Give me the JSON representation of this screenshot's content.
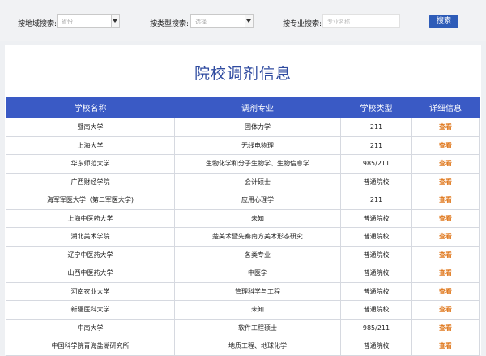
{
  "search": {
    "region_label": "按地域搜索:",
    "region_value": "省份",
    "type_label": "按类型搜索:",
    "type_value": "选择",
    "major_label": "按专业搜索:",
    "major_placeholder": "专业名称",
    "button_label": "搜索"
  },
  "page_title": "院校调剂信息",
  "table": {
    "headers": [
      "学校名称",
      "调剂专业",
      "学校类型",
      "详细信息"
    ],
    "rows": [
      {
        "school": "暨南大学",
        "major": "固体力学",
        "type": "211",
        "link": "查看"
      },
      {
        "school": "上海大学",
        "major": "无线电物理",
        "type": "211",
        "link": "查看"
      },
      {
        "school": "华东师范大学",
        "major": "生物化学和分子生物学、生物信息学",
        "type": "985/211",
        "link": "查看"
      },
      {
        "school": "广西财经学院",
        "major": "会计硕士",
        "type": "普通院校",
        "link": "查看"
      },
      {
        "school": "海军军医大学（第二军医大学)",
        "major": "应用心理学",
        "type": "211",
        "link": "查看"
      },
      {
        "school": "上海中医药大学",
        "major": "未知",
        "type": "普通院校",
        "link": "查看"
      },
      {
        "school": "湖北美术学院",
        "major": "楚美术暨先秦南方美术形态研究",
        "type": "普通院校",
        "link": "查看"
      },
      {
        "school": "辽宁中医药大学",
        "major": "各类专业",
        "type": "普通院校",
        "link": "查看"
      },
      {
        "school": "山西中医药大学",
        "major": "中医学",
        "type": "普通院校",
        "link": "查看"
      },
      {
        "school": "河南农业大学",
        "major": "管理科学与工程",
        "type": "普通院校",
        "link": "查看"
      },
      {
        "school": "新疆医科大学",
        "major": "未知",
        "type": "普通院校",
        "link": "查看"
      },
      {
        "school": "中南大学",
        "major": "软件工程硕士",
        "type": "985/211",
        "link": "查看"
      },
      {
        "school": "中国科学院青海盐湖研究所",
        "major": "地质工程、地球化学",
        "type": "普通院校",
        "link": "查看"
      }
    ]
  }
}
